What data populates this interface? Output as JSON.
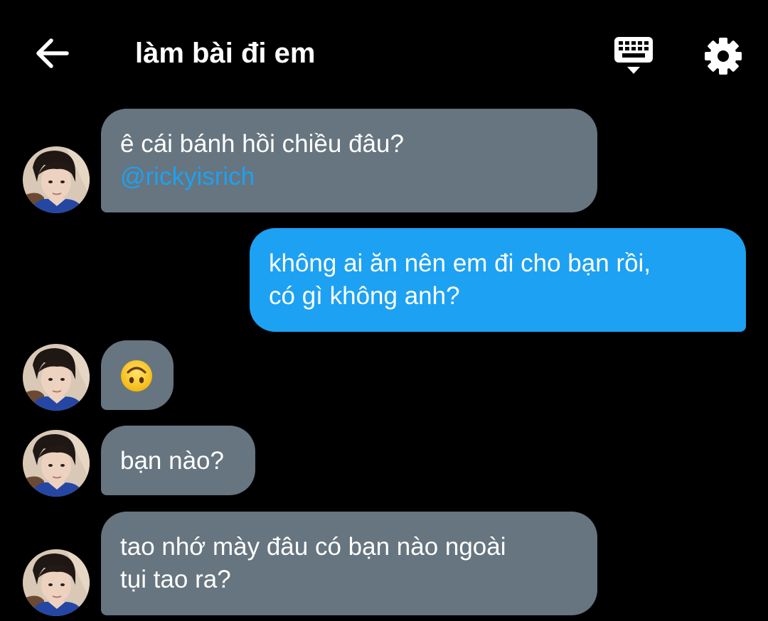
{
  "header": {
    "title": "làm bài đi em",
    "back_icon": "arrow-left-icon",
    "keyboard_icon": "keyboard-icon",
    "settings_icon": "gear-icon"
  },
  "messages": [
    {
      "side": "in",
      "line1": "ê cái bánh hồi chiều đâu?",
      "mention": "@rickyisrich"
    },
    {
      "side": "out",
      "line1": "không ai ăn nên em đi cho bạn rồi,",
      "line2": "có gì không anh?"
    },
    {
      "side": "in",
      "emoji": "upside-down-face-emoji"
    },
    {
      "side": "in",
      "line1": "bạn nào?"
    },
    {
      "side": "in",
      "line1": "tao nhớ mày đâu có bạn nào ngoài",
      "line2": "tụi tao ra?"
    }
  ],
  "colors": {
    "background": "#000000",
    "incoming_bubble": "#66757f",
    "outgoing_bubble": "#1da1f2",
    "mention": "#1da1f2",
    "text": "#ffffff"
  }
}
